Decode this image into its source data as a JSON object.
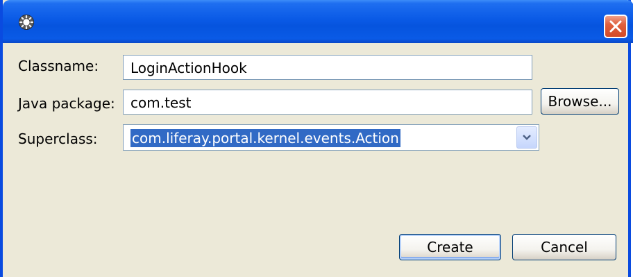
{
  "window": {
    "icon": "gear-icon",
    "close_icon": "close-icon"
  },
  "form": {
    "classname": {
      "label": "Classname:",
      "value": "LoginActionHook"
    },
    "java_package": {
      "label": "Java package:",
      "value": "com.test",
      "browse_label": "Browse..."
    },
    "superclass": {
      "label": "Superclass:",
      "value": "com.liferay.portal.kernel.events.Action",
      "dropdown_icon": "chevron-down-icon"
    }
  },
  "actions": {
    "create_label": "Create",
    "cancel_label": "Cancel"
  },
  "colors": {
    "titlebar": "#0a5ae6",
    "window_bg": "#ece9d8",
    "selection": "#316ac5",
    "close_button": "#d24a28"
  }
}
